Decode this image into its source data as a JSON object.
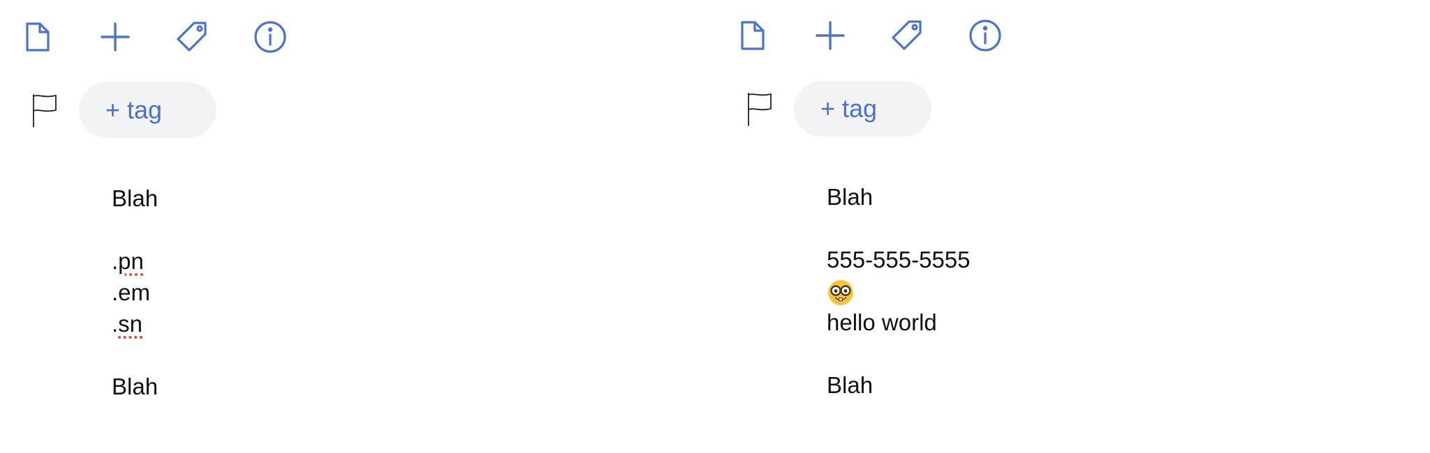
{
  "accent_color": "#4c73c4",
  "panes": [
    {
      "toolbar": {
        "icons": [
          "document-icon",
          "plus-icon",
          "tag-icon",
          "info-icon"
        ]
      },
      "tag_button_label": "+ tag",
      "note": {
        "line_1": "Blah",
        "line_2_prefix": ".",
        "line_2_word": "pn",
        "line_3": ".em",
        "line_4_prefix": ".",
        "line_4_word": "sn",
        "line_5": "Blah"
      }
    },
    {
      "toolbar": {
        "icons": [
          "document-icon",
          "plus-icon",
          "tag-icon",
          "info-icon"
        ]
      },
      "tag_button_label": "+ tag",
      "note": {
        "line_1": "Blah",
        "line_2": "555-555-5555",
        "line_3_emoji": "nerd-face-emoji",
        "line_4": "hello world",
        "line_5": "Blah"
      }
    }
  ]
}
